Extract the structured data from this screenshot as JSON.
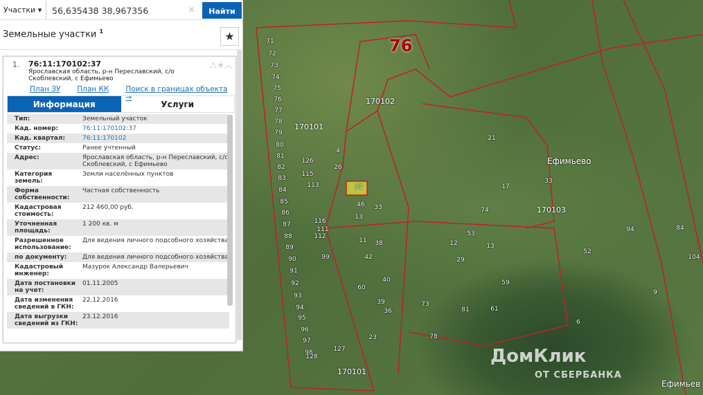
{
  "search": {
    "mode": "Участки",
    "query": "56,635438 38,967356",
    "clear": "×",
    "button": "Найти"
  },
  "panel": {
    "title": "Земельные участки",
    "count": "1",
    "favorite_icon": "star-icon"
  },
  "result": {
    "index": "1.",
    "cad_number": "76:11:170102:37",
    "address": "Ярославская область, р-н Переславский, с/о Скоблевский, с Ефимьево",
    "links": [
      "План ЗУ →",
      "План КК →",
      "Поиск в границах объекта →"
    ],
    "tabs": [
      "Информация",
      "Услуги"
    ],
    "rows": [
      {
        "k": "Тип:",
        "v": "Земельный участок"
      },
      {
        "k": "Кад. номер:",
        "v": "76:11:170102:37"
      },
      {
        "k": "Кад. квартал:",
        "v": "76:11:170102"
      },
      {
        "k": "Статус:",
        "v": "Ранее учтенный"
      },
      {
        "k": "Адрес:",
        "v": "Ярославская область, р-н Переславский, с/о Скоблевский, с Ефимьево"
      },
      {
        "k": "Категория земель:",
        "v": "Земли населённых пунктов"
      },
      {
        "k": "Форма собственности:",
        "v": "Частная собственность"
      },
      {
        "k": "Кадастровая стоимость:",
        "v": "212 460,00 руб."
      },
      {
        "k": "Уточненная площадь:",
        "v": "1 200 кв. м"
      },
      {
        "k": "Разрешенное использование:",
        "v": "Для ведения личного подсобного хозяйства"
      },
      {
        "k": "по документу:",
        "v": "Для ведения личного подсобного хозяйства"
      },
      {
        "k": "Кадастровый инженер:",
        "v": "Мазурок Александр Валерьевич"
      },
      {
        "k": "Дата постановки на учет:",
        "v": "01.11.2005"
      },
      {
        "k": "Дата изменения сведений в ГКН:",
        "v": "22.12.2016"
      },
      {
        "k": "Дата выгрузки сведений из ГКН:",
        "v": "23.12.2016"
      }
    ]
  },
  "map": {
    "district": "76",
    "quarters": [
      "170102",
      "170101",
      "170103",
      "170101"
    ],
    "village": "Ефимьево",
    "village2": "Ефимьев",
    "parcels": [
      "71",
      "72",
      "73",
      "74",
      "75",
      "76",
      "77",
      "78",
      "79",
      "80",
      "81",
      "82",
      "83",
      "84",
      "85",
      "86",
      "87",
      "88",
      "89",
      "90",
      "91",
      "92",
      "93",
      "94",
      "95",
      "96",
      "97",
      "98",
      "128",
      "126",
      "113",
      "115",
      "116",
      "112",
      "111",
      "99",
      "4",
      "26",
      "46",
      "13",
      "33",
      "11",
      "38",
      "42",
      "60",
      "40",
      "39",
      "36",
      "23",
      "127",
      "37",
      "17",
      "74",
      "59",
      "61",
      "78",
      "73",
      "29",
      "53",
      "52",
      "104",
      "94",
      "84",
      "33",
      "21",
      "9",
      "6",
      "81",
      "13",
      "12"
    ],
    "watermark": "ДомКлик",
    "watermark_sub": "ОТ СБЕРБАНКА"
  }
}
